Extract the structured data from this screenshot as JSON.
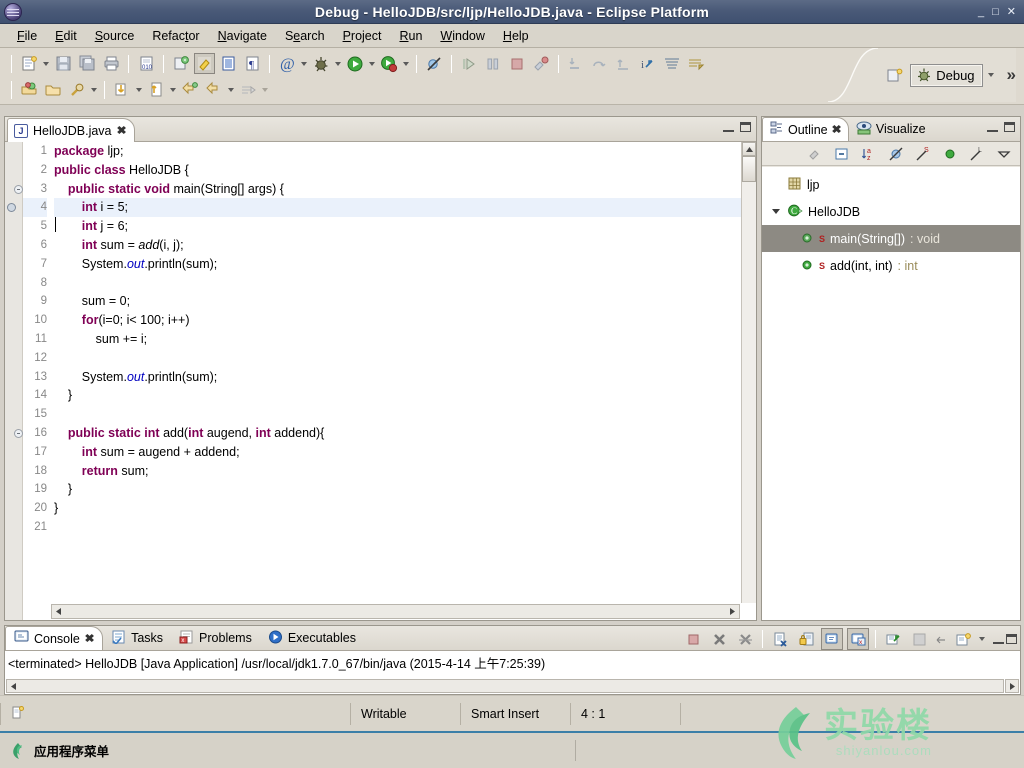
{
  "window": {
    "title": "Debug - HelloJDB/src/ljp/HelloJDB.java - Eclipse Platform",
    "app_icon": "eclipse-icon",
    "minimize_label": "_",
    "maximize_label": "□",
    "close_label": "✕"
  },
  "menubar": {
    "items": [
      {
        "label": "File",
        "mnemonic": "F"
      },
      {
        "label": "Edit",
        "mnemonic": "E"
      },
      {
        "label": "Source",
        "mnemonic": "S"
      },
      {
        "label": "Refactor",
        "mnemonic": "t"
      },
      {
        "label": "Navigate",
        "mnemonic": "N"
      },
      {
        "label": "Search",
        "mnemonic": "e"
      },
      {
        "label": "Project",
        "mnemonic": "P"
      },
      {
        "label": "Run",
        "mnemonic": "R"
      },
      {
        "label": "Window",
        "mnemonic": "W"
      },
      {
        "label": "Help",
        "mnemonic": "H"
      }
    ]
  },
  "toolbar": {
    "row1_icons": [
      "new-wizard-icon",
      "save-icon",
      "save-all-icon",
      "print-icon",
      "build-all-icon",
      "new-java-project-icon",
      "open-type-icon",
      "toggle-mark-occurrences-icon",
      "show-whitespace-icon",
      "link-icon",
      "debug-icon",
      "run-icon",
      "run-coverage-icon",
      "skip-breakpoints-icon"
    ],
    "row2_icons": [
      "open-perspective-icon",
      "open-folder-icon",
      "search-icon",
      "step-into-icon",
      "step-over-icon",
      "back-icon",
      "forward-icon",
      "next-annotation-icon"
    ],
    "debug_icons": [
      "resume-icon",
      "suspend-icon",
      "terminate-icon",
      "disconnect-icon",
      "step-into-dbg-icon",
      "step-over-dbg-icon",
      "step-return-icon",
      "drop-to-frame-icon",
      "use-step-filters-icon",
      "instruction-step-icon"
    ],
    "perspective": {
      "open_perspective_label": "open-perspective-icon",
      "active_label": "Debug",
      "active_icon": "debug-perspective-icon",
      "overflow_label": "»"
    }
  },
  "editor": {
    "tab": {
      "label": "HelloJDB.java",
      "icon": "java-file-icon",
      "close": "✖"
    },
    "controls": {
      "minimize": "minimize-icon",
      "maximize": "maximize-icon"
    },
    "cursor_line": 4,
    "lines": [
      {
        "n": 1,
        "fold": false,
        "marker": false,
        "html": "<span class=\"k\">package</span> ljp;"
      },
      {
        "n": 2,
        "fold": false,
        "marker": false,
        "html": "<span class=\"k\">public class</span> HelloJDB {"
      },
      {
        "n": 3,
        "fold": true,
        "marker": false,
        "html": "    <span class=\"k\">public static void</span> main(String[] args) {"
      },
      {
        "n": 4,
        "fold": false,
        "marker": true,
        "html": "        <span class=\"k\">int</span> i = 5;"
      },
      {
        "n": 5,
        "fold": false,
        "marker": false,
        "html": "        <span class=\"k\">int</span> j = 6;"
      },
      {
        "n": 6,
        "fold": false,
        "marker": false,
        "html": "        <span class=\"k\">int</span> sum = <span class=\"it\">add</span>(i, j);"
      },
      {
        "n": 7,
        "fold": false,
        "marker": false,
        "html": "        System.<span class=\"st\">out</span>.println(sum);"
      },
      {
        "n": 8,
        "fold": false,
        "marker": false,
        "html": ""
      },
      {
        "n": 9,
        "fold": false,
        "marker": false,
        "html": "        sum = 0;"
      },
      {
        "n": 10,
        "fold": false,
        "marker": false,
        "html": "        <span class=\"k\">for</span>(i=0; i&lt; 100; i++)"
      },
      {
        "n": 11,
        "fold": false,
        "marker": false,
        "html": "            sum += i;"
      },
      {
        "n": 12,
        "fold": false,
        "marker": false,
        "html": ""
      },
      {
        "n": 13,
        "fold": false,
        "marker": false,
        "html": "        System.<span class=\"st\">out</span>.println(sum);"
      },
      {
        "n": 14,
        "fold": false,
        "marker": false,
        "html": "    }"
      },
      {
        "n": 15,
        "fold": false,
        "marker": false,
        "html": ""
      },
      {
        "n": 16,
        "fold": true,
        "marker": false,
        "html": "    <span class=\"k\">public static int</span> add(<span class=\"k\">int</span> augend, <span class=\"k\">int</span> addend){"
      },
      {
        "n": 17,
        "fold": false,
        "marker": false,
        "html": "        <span class=\"k\">int</span> sum = augend + addend;"
      },
      {
        "n": 18,
        "fold": false,
        "marker": false,
        "html": "        <span class=\"k\">return</span> sum;"
      },
      {
        "n": 19,
        "fold": false,
        "marker": false,
        "html": "    }"
      },
      {
        "n": 20,
        "fold": false,
        "marker": false,
        "html": "}"
      },
      {
        "n": 21,
        "fold": false,
        "marker": false,
        "html": ""
      }
    ]
  },
  "outline": {
    "tabs": [
      {
        "label": "Outline",
        "icon": "outline-icon",
        "active": true,
        "close": "✖"
      },
      {
        "label": "Visualize",
        "icon": "visualize-icon",
        "active": false,
        "close": ""
      }
    ],
    "controls": {
      "minimize": "minimize-icon",
      "maximize": "maximize-icon"
    },
    "toolbar_icons": [
      "focus-on-active-task-icon",
      "collapse-all-icon",
      "sort-icon",
      "hide-fields-icon",
      "hide-static-icon",
      "hide-nonpublic-icon",
      "hide-local-types-icon",
      "view-menu-icon"
    ],
    "tree": [
      {
        "indent": 0,
        "twisty": false,
        "icon": "package-icon",
        "label": "ljp",
        "static": false,
        "ret": "",
        "selected": false
      },
      {
        "indent": 0,
        "twisty": true,
        "icon": "class-icon",
        "label": "HelloJDB",
        "static": false,
        "ret": "",
        "selected": false
      },
      {
        "indent": 1,
        "twisty": false,
        "icon": "method-icon",
        "label": "main(String[])",
        "static": true,
        "ret": ": void",
        "selected": true
      },
      {
        "indent": 1,
        "twisty": false,
        "icon": "method-icon",
        "label": "add(int, int)",
        "static": true,
        "ret": ": int",
        "selected": false
      }
    ]
  },
  "console": {
    "tabs": [
      {
        "label": "Console",
        "icon": "console-icon",
        "active": true,
        "close": "✖"
      },
      {
        "label": "Tasks",
        "icon": "tasks-icon",
        "active": false,
        "close": ""
      },
      {
        "label": "Problems",
        "icon": "problems-icon",
        "active": false,
        "close": ""
      },
      {
        "label": "Executables",
        "icon": "executables-icon",
        "active": false,
        "close": ""
      }
    ],
    "toolbar_icons": [
      "terminate-icon",
      "remove-launch-icon",
      "remove-all-terminated-icon",
      "clear-console-icon",
      "scroll-lock-icon",
      "pin-console-icon",
      "display-selected-console-icon",
      "open-console-icon",
      "word-wrap-icon",
      "view-menu-icon"
    ],
    "controls": {
      "minimize": "minimize-icon",
      "maximize": "maximize-icon"
    },
    "output": "<terminated> HelloJDB [Java Application] /usr/local/jdk1.7.0_67/bin/java (2015-4-14 上午7:25:39)"
  },
  "statusbar": {
    "icon": "writable-doc-icon",
    "writable": "Writable",
    "insert_mode": "Smart Insert",
    "position": "4 : 1"
  },
  "taskbar": {
    "icon": "app-menu-icon",
    "label": "应用程序菜单"
  },
  "watermark": {
    "cn": "实验楼",
    "en": "shiyanlou.com",
    "color": "#8fd9a8"
  },
  "colors": {
    "titlebar": "#4a5a78",
    "chrome": "#d9d5cb",
    "toolbar": "#ded9cf",
    "keyword": "#7f0055",
    "static_field": "#0000c0",
    "selection": "#8d8a83",
    "line_highlight": "#eaf1fb",
    "return_type": "#9a8c5a"
  }
}
